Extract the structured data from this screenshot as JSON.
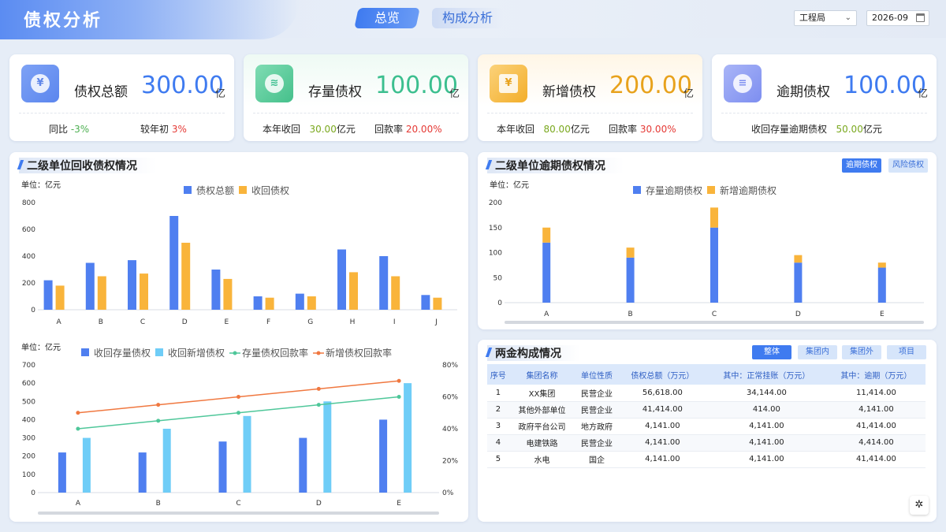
{
  "header": {
    "title": "债权分析",
    "tabs": [
      {
        "label": "总览",
        "active": true
      },
      {
        "label": "构成分析",
        "active": false
      }
    ],
    "org_select": "工程局",
    "date": "2026-09"
  },
  "kpis": [
    {
      "label": "债权总额",
      "value": "300.00",
      "unit": "亿",
      "value_color": "#3f7bf0",
      "icon": "money-bag-icon",
      "sub1_label": "同比",
      "sub1_value": "-3%",
      "sub2_label": "较年初",
      "sub2_value": "3%"
    },
    {
      "label": "存量债权",
      "value": "100.00",
      "unit": "亿",
      "value_color": "#3cbf8f",
      "icon": "coins-icon",
      "sub1_label": "本年收回",
      "sub1_value": "30.00",
      "sub1_unit": "亿元",
      "sub2_label": "回款率",
      "sub2_value": "20.00%"
    },
    {
      "label": "新增债权",
      "value": "200.00",
      "unit": "亿",
      "value_color": "#e8a21c",
      "icon": "calendar-yen-icon",
      "sub1_label": "本年收回",
      "sub1_value": "80.00",
      "sub1_unit": "亿元",
      "sub2_label": "回款率",
      "sub2_value": "30.00%"
    },
    {
      "label": "逾期债权",
      "value": "100.00",
      "unit": "亿",
      "value_color": "#3f7bf0",
      "icon": "database-icon",
      "sub1_label": "收回存量逾期债权",
      "sub1_value": "50.00",
      "sub1_unit": "亿元"
    }
  ],
  "panels": {
    "recovery_title": "二级单位回收债权情况",
    "overdue_title": "二级单位逾期债权情况",
    "overdue_chips": [
      "逾期债权",
      "风险债权"
    ],
    "funds_title": "两金构成情况",
    "funds_chips": [
      "整体",
      "集团内",
      "集团外",
      "项目"
    ]
  },
  "chart_data": [
    {
      "type": "bar",
      "unit_label": "单位：亿元",
      "categories": [
        "A",
        "B",
        "C",
        "D",
        "E",
        "F",
        "G",
        "H",
        "I",
        "J"
      ],
      "series": [
        {
          "name": "债权总额",
          "color": "#4f7ff0",
          "values": [
            220,
            350,
            370,
            700,
            300,
            100,
            120,
            450,
            400,
            110
          ]
        },
        {
          "name": "收回债权",
          "color": "#f9b43b",
          "values": [
            180,
            250,
            270,
            500,
            230,
            90,
            100,
            280,
            250,
            90
          ]
        }
      ],
      "ylim": [
        0,
        800
      ],
      "yticks": [
        0,
        200,
        400,
        600,
        800
      ]
    },
    {
      "type": "bar",
      "subtype": "stacked",
      "unit_label": "单位：亿元",
      "categories": [
        "A",
        "B",
        "C",
        "D",
        "E"
      ],
      "series": [
        {
          "name": "存量逾期债权",
          "color": "#4f7ff0",
          "values": [
            120,
            90,
            150,
            80,
            70
          ]
        },
        {
          "name": "新增逾期债权",
          "color": "#f9b43b",
          "values": [
            30,
            20,
            40,
            15,
            10
          ]
        }
      ],
      "ylim": [
        0,
        200
      ],
      "yticks": [
        0,
        50,
        100,
        150,
        200
      ]
    },
    {
      "type": "bar",
      "subtype": "bar-line-combo",
      "unit_label": "单位：亿元",
      "categories": [
        "A",
        "B",
        "C",
        "D",
        "E"
      ],
      "series": [
        {
          "name": "收回存量债权",
          "color": "#4f7ff0",
          "kind": "bar",
          "values": [
            220,
            220,
            280,
            300,
            400
          ]
        },
        {
          "name": "收回新增债权",
          "color": "#6fcdf7",
          "kind": "bar",
          "values": [
            300,
            350,
            420,
            500,
            600
          ]
        },
        {
          "name": "存量债权回款率",
          "color": "#4fc79a",
          "kind": "line",
          "axis": "right",
          "values": [
            40,
            45,
            50,
            55,
            60
          ]
        },
        {
          "name": "新增债权回款率",
          "color": "#f07840",
          "kind": "line",
          "axis": "right",
          "values": [
            50,
            55,
            60,
            65,
            70
          ]
        }
      ],
      "ylim": [
        0,
        700
      ],
      "yticks": [
        0,
        100,
        200,
        300,
        400,
        500,
        600,
        700
      ],
      "y2lim": [
        0,
        80
      ],
      "y2ticks": [
        "0%",
        "20%",
        "40%",
        "60%",
        "80%"
      ]
    }
  ],
  "table": {
    "headers": [
      "序号",
      "集团名称",
      "单位性质",
      "债权总额（万元）",
      "其中：正常挂账（万元）",
      "其中：逾期（万元）"
    ],
    "rows": [
      [
        "1",
        "XX集团",
        "民营企业",
        "56,618.00",
        "34,144.00",
        "11,414.00"
      ],
      [
        "2",
        "其他外部单位",
        "民营企业",
        "41,414.00",
        "414.00",
        "4,141.00"
      ],
      [
        "3",
        "政府平台公司",
        "地方政府",
        "4,141.00",
        "4,141.00",
        "41,414.00"
      ],
      [
        "4",
        "电建铁路",
        "民营企业",
        "4,141.00",
        "4,141.00",
        "4,414.00"
      ],
      [
        "5",
        "水电",
        "国企",
        "4,141.00",
        "4,141.00",
        "41,414.00"
      ]
    ]
  },
  "corner_icon": "settings-cog-icon"
}
